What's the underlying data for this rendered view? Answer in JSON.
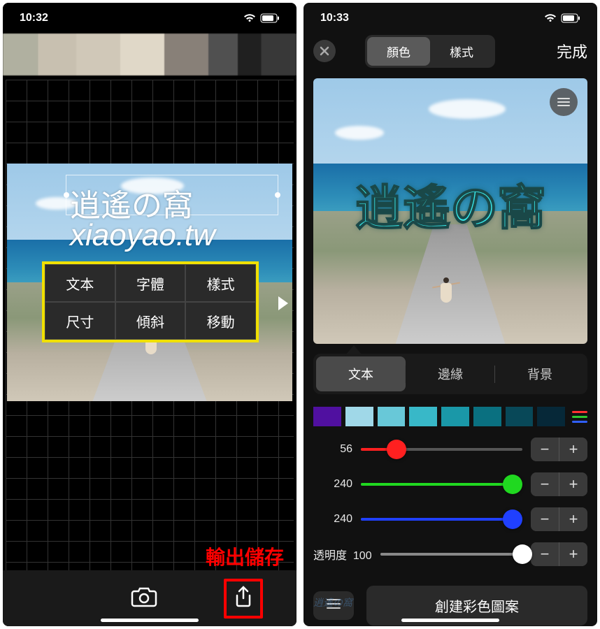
{
  "status": {
    "time_left": "10:32",
    "time_right": "10:33"
  },
  "left": {
    "overlay_text1": "逍遙の窩",
    "overlay_text2": "xiaoyao.tw",
    "options": [
      "文本",
      "字體",
      "樣式",
      "尺寸",
      "傾斜",
      "移動"
    ],
    "export_label": "輸出儲存"
  },
  "right": {
    "seg": {
      "color": "顏色",
      "style": "樣式"
    },
    "done": "完成",
    "big_text": "逍遙の窩",
    "sub_tabs": {
      "text": "文本",
      "edge": "邊緣",
      "bg": "背景"
    },
    "palette": [
      "#5010a0",
      "#a0d8e8",
      "#68c8d8",
      "#38b8c8",
      "#1a98a8",
      "#0a7080",
      "#084858",
      "#062838"
    ],
    "palette_menu_colors": [
      "#ff3030",
      "#30c830",
      "#3060ff"
    ],
    "sliders": {
      "r": {
        "label": "56",
        "value": 56,
        "max": 255,
        "color": "#ff2020"
      },
      "g": {
        "label": "240",
        "value": 240,
        "max": 255,
        "color": "#20d820"
      },
      "b": {
        "label": "240",
        "value": 240,
        "max": 255,
        "color": "#2040ff"
      },
      "a": {
        "label_text": "透明度",
        "label": "100",
        "value": 100,
        "max": 100,
        "color": "#fff"
      }
    },
    "create_btn": "創建彩色圖案",
    "watermark": "逍遙の窩"
  }
}
